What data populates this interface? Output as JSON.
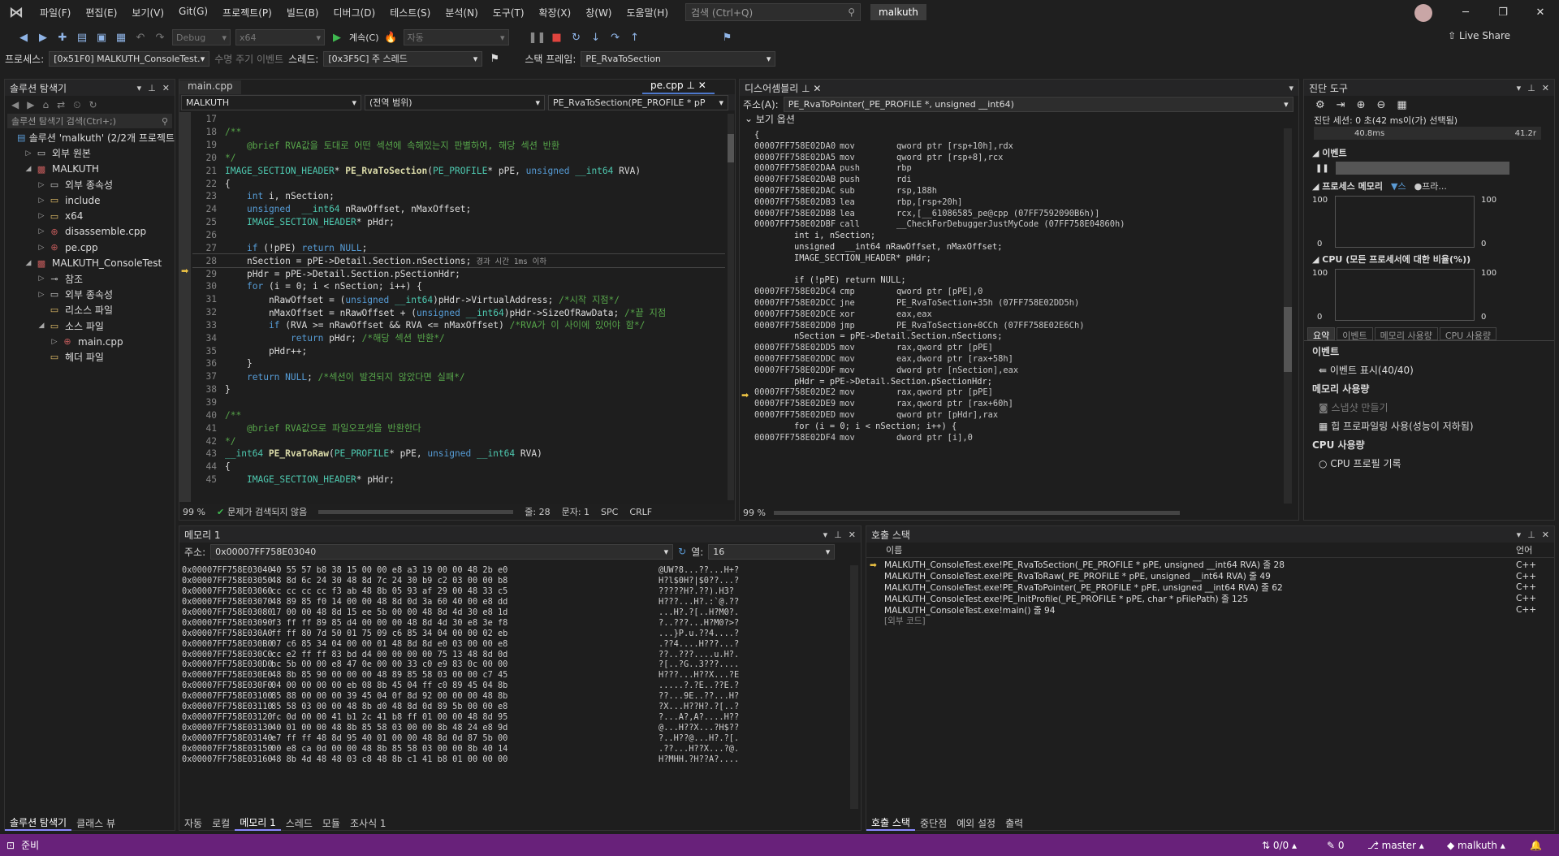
{
  "menu": [
    "파일(F)",
    "편집(E)",
    "보기(V)",
    "Git(G)",
    "프로젝트(P)",
    "빌드(B)",
    "디버그(D)",
    "테스트(S)",
    "분석(N)",
    "도구(T)",
    "확장(X)",
    "창(W)",
    "도움말(H)"
  ],
  "search_placeholder": "검색 (Ctrl+Q)",
  "solution_badge": "malkuth",
  "toolbar": {
    "config": "Debug",
    "platform": "x64",
    "continue": "계속(C)",
    "auto": "자동",
    "liveshare": "Live Share"
  },
  "toolbar2": {
    "process_label": "프로세스:",
    "process": "[0x51F0] MALKUTH_ConsoleTest.",
    "lifecycle": "수명 주기 이벤트",
    "thread_label": "스레드:",
    "thread": "[0x3F5C] 주 스레드",
    "stack_label": "스택 프레임:",
    "stack": "PE_RvaToSection"
  },
  "solution_explorer": {
    "title": "솔루션 탐색기",
    "search": "솔루션 탐색기 검색(Ctrl+;)",
    "items": [
      {
        "label": "솔루션 'malkuth' (2/2개 프로젝트"
      },
      {
        "label": "외부 원본"
      },
      {
        "label": "MALKUTH"
      },
      {
        "label": "외부 종속성"
      },
      {
        "label": "include"
      },
      {
        "label": "x64"
      },
      {
        "label": "disassemble.cpp"
      },
      {
        "label": "pe.cpp"
      },
      {
        "label": "MALKUTH_ConsoleTest"
      },
      {
        "label": "참조"
      },
      {
        "label": "외부 종속성"
      },
      {
        "label": "리소스 파일"
      },
      {
        "label": "소스 파일"
      },
      {
        "label": "main.cpp"
      },
      {
        "label": "헤더 파일"
      }
    ],
    "tabs": [
      "솔루션 탐색기",
      "클래스 뷰"
    ]
  },
  "editor": {
    "tabs": [
      "main.cpp",
      "pe.cpp"
    ],
    "nav": [
      "MALKUTH",
      "(전역 범위)",
      "PE_RvaToSection(PE_PROFILE * pP"
    ],
    "lines": [
      {
        "n": "17",
        "t": ""
      },
      {
        "n": "18",
        "t": "/**"
      },
      {
        "n": "19",
        "t": "    @brief RVA값을 토대로 어떤 섹션에 속해있는지 판별하여, 해당 섹션 반환"
      },
      {
        "n": "20",
        "t": "*/"
      },
      {
        "n": "21",
        "t": "IMAGE_SECTION_HEADER* PE_RvaToSection(PE_PROFILE* pPE, unsigned __int64 RVA)"
      },
      {
        "n": "22",
        "t": "{"
      },
      {
        "n": "23",
        "t": "    int i, nSection;"
      },
      {
        "n": "24",
        "t": "    unsigned  __int64 nRawOffset, nMaxOffset;"
      },
      {
        "n": "25",
        "t": "    IMAGE_SECTION_HEADER* pHdr;"
      },
      {
        "n": "26",
        "t": ""
      },
      {
        "n": "27",
        "t": "    if (!pPE) return NULL;"
      },
      {
        "n": "28",
        "t": "    nSection = pPE->Detail.Section.nSections;"
      },
      {
        "n": "29",
        "t": "    pHdr = pPE->Detail.Section.pSectionHdr;"
      },
      {
        "n": "30",
        "t": "    for (i = 0; i < nSection; i++) {"
      },
      {
        "n": "31",
        "t": "        nRawOffset = (unsigned __int64)pHdr->VirtualAddress; /*시작 지점*/"
      },
      {
        "n": "32",
        "t": "        nMaxOffset = nRawOffset + (unsigned __int64)pHdr->SizeOfRawData; /*끝 지점"
      },
      {
        "n": "33",
        "t": "        if (RVA >= nRawOffset && RVA <= nMaxOffset) /*RVA가 이 사이에 있어야 함*/"
      },
      {
        "n": "34",
        "t": "            return pHdr; /*해당 섹션 반환*/"
      },
      {
        "n": "35",
        "t": "        pHdr++;"
      },
      {
        "n": "36",
        "t": "    }"
      },
      {
        "n": "37",
        "t": "    return NULL; /*섹션이 발견되지 않았다면 실패*/"
      },
      {
        "n": "38",
        "t": "}"
      },
      {
        "n": "39",
        "t": ""
      },
      {
        "n": "40",
        "t": "/**"
      },
      {
        "n": "41",
        "t": "    @brief RVA값으로 파일오프셋을 반환한다"
      },
      {
        "n": "42",
        "t": "*/"
      },
      {
        "n": "43",
        "t": "__int64 PE_RvaToRaw(PE_PROFILE* pPE, unsigned __int64 RVA)"
      },
      {
        "n": "44",
        "t": "{"
      },
      {
        "n": "45",
        "t": "    IMAGE_SECTION_HEADER* pHdr;"
      }
    ],
    "elapsed": "경과 시간 1ms 이하",
    "zoom": "99 %",
    "issues": "문제가 검색되지 않음",
    "line": "줄: 28",
    "col": "문자: 1",
    "spc": "SPC",
    "crlf": "CRLF"
  },
  "disasm": {
    "title": "디스어셈블리",
    "address_label": "주소(A):",
    "address": "PE_RvaToPointer(_PE_PROFILE *, unsigned __int64)",
    "options": "보기 옵션",
    "zoom": "99 %",
    "lines": [
      {
        "k": "src",
        "t": "{"
      },
      {
        "k": "asm",
        "a": "00007FF758E02DA0",
        "o": "mov",
        "r": "qword ptr [rsp+10h],rdx"
      },
      {
        "k": "asm",
        "a": "00007FF758E02DA5",
        "o": "mov",
        "r": "qword ptr [rsp+8],rcx"
      },
      {
        "k": "asm",
        "a": "00007FF758E02DAA",
        "o": "push",
        "r": "rbp"
      },
      {
        "k": "asm",
        "a": "00007FF758E02DAB",
        "o": "push",
        "r": "rdi"
      },
      {
        "k": "asm",
        "a": "00007FF758E02DAC",
        "o": "sub",
        "r": "rsp,188h"
      },
      {
        "k": "asm",
        "a": "00007FF758E02DB3",
        "o": "lea",
        "r": "rbp,[rsp+20h]"
      },
      {
        "k": "asm",
        "a": "00007FF758E02DB8",
        "o": "lea",
        "r": "rcx,[__61086585_pe@cpp (07FF7592090B6h)]"
      },
      {
        "k": "asm",
        "a": "00007FF758E02DBF",
        "o": "call",
        "r": "__CheckForDebuggerJustMyCode (07FF758E04860h)"
      },
      {
        "k": "src",
        "t": "    int i, nSection;"
      },
      {
        "k": "src",
        "t": "    unsigned  __int64 nRawOffset, nMaxOffset;"
      },
      {
        "k": "src",
        "t": "    IMAGE_SECTION_HEADER* pHdr;"
      },
      {
        "k": "src",
        "t": ""
      },
      {
        "k": "src",
        "t": "    if (!pPE) return NULL;"
      },
      {
        "k": "asm",
        "a": "00007FF758E02DC4",
        "o": "cmp",
        "r": "qword ptr [pPE],0"
      },
      {
        "k": "asm",
        "a": "00007FF758E02DCC",
        "o": "jne",
        "r": "PE_RvaToSection+35h (07FF758E02DD5h)"
      },
      {
        "k": "asm",
        "a": "00007FF758E02DCE",
        "o": "xor",
        "r": "eax,eax"
      },
      {
        "k": "asm",
        "a": "00007FF758E02DD0",
        "o": "jmp",
        "r": "PE_RvaToSection+0CCh (07FF758E02E6Ch)"
      },
      {
        "k": "src",
        "t": "    nSection = pPE->Detail.Section.nSections;"
      },
      {
        "k": "asm",
        "a": "00007FF758E02DD5",
        "o": "mov",
        "r": "rax,qword ptr [pPE]"
      },
      {
        "k": "asm",
        "a": "00007FF758E02DDC",
        "o": "mov",
        "r": "eax,dword ptr [rax+58h]"
      },
      {
        "k": "asm",
        "a": "00007FF758E02DDF",
        "o": "mov",
        "r": "dword ptr [nSection],eax"
      },
      {
        "k": "src",
        "t": "    pHdr = pPE->Detail.Section.pSectionHdr;"
      },
      {
        "k": "asm",
        "a": "00007FF758E02DE2",
        "o": "mov",
        "r": "rax,qword ptr [pPE]"
      },
      {
        "k": "asm",
        "a": "00007FF758E02DE9",
        "o": "mov",
        "r": "rax,qword ptr [rax+60h]"
      },
      {
        "k": "asm",
        "a": "00007FF758E02DED",
        "o": "mov",
        "r": "qword ptr [pHdr],rax"
      },
      {
        "k": "src",
        "t": "    for (i = 0; i < nSection; i++) {"
      },
      {
        "k": "asm",
        "a": "00007FF758E02DF4",
        "o": "mov",
        "r": "dword ptr [i],0"
      }
    ]
  },
  "diag": {
    "title": "진단 도구",
    "session": "진단 세션: 0 초(42 ms이(가) 선택됨)",
    "t1": "40.8ms",
    "t2": "41.2r",
    "events": "이벤트",
    "proc_mem": "프로세스 메모리",
    "legend1": "스",
    "legend2": "프라...",
    "y100": "100",
    "y0": "0",
    "cpu": "CPU (모든 프로세서에 대한 비율(%))",
    "tabs": [
      "요약",
      "이벤트",
      "메모리 사용량",
      "CPU 사용량"
    ],
    "sec_events": "이벤트",
    "show_events": "이벤트 표시(40/40)",
    "sec_mem": "메모리 사용량",
    "snapshot": "스냅샷 만들기",
    "heap": "힙 프로파일링 사용(성능이 저하됨)",
    "sec_cpu": "CPU 사용량",
    "cpu_record": "CPU 프로필 기록"
  },
  "memory": {
    "title": "메모리 1",
    "addr_label": "주소:",
    "addr": "0x00007FF758E03040",
    "col_label": "열:",
    "cols": "16",
    "rows": [
      {
        "a": "0x00007FF758E03040",
        "h": "40 55 57 b8 38 15 00 00 e8 a3 19 00 00 48 2b e0",
        "c": "@UW?8...??...H+?"
      },
      {
        "a": "0x00007FF758E03050",
        "h": "48 8d 6c 24 30 48 8d 7c 24 30 b9 c2 03 00 00 b8",
        "c": "H?l$0H?|$0??...?"
      },
      {
        "a": "0x00007FF758E03060",
        "h": "cc cc cc cc f3 ab 48 8b 05 93 af 29 00 48 33 c5",
        "c": "?????H?.??).H3?"
      },
      {
        "a": "0x00007FF758E03070",
        "h": "48 89 85 f0 14 00 00 48 8d 0d 3a 60 40 00 e8 dd",
        "c": "H???...H?.:`@.??"
      },
      {
        "a": "0x00007FF758E03080",
        "h": "17 00 00 48 8d 15 ee 5b 00 00 48 8d 4d 30 e8 1d",
        "c": "...H?.?[..H?M0?."
      },
      {
        "a": "0x00007FF758E03090",
        "h": "f3 ff ff 89 85 d4 00 00 00 48 8d 4d 30 e8 3e f8",
        "c": "?..???...H?M0?>?"
      },
      {
        "a": "0x00007FF758E030A0",
        "h": "ff ff 80 7d 50 01 75 09 c6 85 34 04 00 00 02 eb",
        "c": "...}P.u.??4....?"
      },
      {
        "a": "0x00007FF758E030B0",
        "h": "07 c6 85 34 04 00 00 01 48 8d 8d e0 03 00 00 e8",
        "c": ".??4....H???...?"
      },
      {
        "a": "0x00007FF758E030C0",
        "h": "cc e2 ff ff 83 bd d4 00 00 00 00 75 13 48 8d 0d",
        "c": "??..???....u.H?."
      },
      {
        "a": "0x00007FF758E030D0",
        "h": "bc 5b 00 00 e8 47 0e 00 00 33 c0 e9 83 0c 00 00",
        "c": "?[..?G..3???...."
      },
      {
        "a": "0x00007FF758E030E0",
        "h": "48 8b 85 90 00 00 00 48 89 85 58 03 00 00 c7 45",
        "c": "H???...H??X...?E"
      },
      {
        "a": "0x00007FF758E030F0",
        "h": "04 00 00 00 00 eb 08 8b 45 04 ff c0 89 45 04 8b",
        "c": ".....?.?E..??E.?"
      },
      {
        "a": "0x00007FF758E03100",
        "h": "85 88 00 00 00 39 45 04 0f 8d 92 00 00 00 48 8b",
        "c": "??...9E..??...H?"
      },
      {
        "a": "0x00007FF758E03110",
        "h": "85 58 03 00 00 48 8b d0 48 8d 0d 89 5b 00 00 e8",
        "c": "?X...H??H?.?[..?"
      },
      {
        "a": "0x00007FF758E03120",
        "h": "fc 0d 00 00 41 b1 2c 41 b8 ff 01 00 00 48 8d 95",
        "c": "?...A?,A?....H??"
      },
      {
        "a": "0x00007FF758E03130",
        "h": "40 01 00 00 48 8b 85 58 03 00 00 8b 48 24 e8 9d",
        "c": "@...H??X...?H$??"
      },
      {
        "a": "0x00007FF758E03140",
        "h": "e7 ff ff 48 8d 95 40 01 00 00 48 8d 0d 87 5b 00",
        "c": "?..H??@...H?.?[."
      },
      {
        "a": "0x00007FF758E03150",
        "h": "00 e8 ca 0d 00 00 48 8b 85 58 03 00 00 8b 40 14",
        "c": ".??...H??X...?@."
      },
      {
        "a": "0x00007FF758E03160",
        "h": "48 8b 4d 48 48 03 c8 48 8b c1 41 b8 01 00 00 00",
        "c": "H?MHH.?H??A?...."
      }
    ]
  },
  "left_bottom_tabs": [
    "자동",
    "로컬",
    "메모리 1",
    "스레드",
    "모듈",
    "조사식 1"
  ],
  "callstack": {
    "title": "호출 스택",
    "col_name": "이름",
    "col_lang": "언어",
    "rows": [
      {
        "n": "MALKUTH_ConsoleTest.exe!PE_RvaToSection(_PE_PROFILE * pPE, unsigned __int64 RVA) 줄 28",
        "l": "C++"
      },
      {
        "n": "MALKUTH_ConsoleTest.exe!PE_RvaToRaw(_PE_PROFILE * pPE, unsigned __int64 RVA) 줄 49",
        "l": "C++"
      },
      {
        "n": "MALKUTH_ConsoleTest.exe!PE_RvaToPointer(_PE_PROFILE * pPE, unsigned __int64 RVA) 줄 62",
        "l": "C++"
      },
      {
        "n": "MALKUTH_ConsoleTest.exe!PE_InitProfile(_PE_PROFILE * pPE, char * pFilePath) 줄 125",
        "l": "C++"
      },
      {
        "n": "MALKUTH_ConsoleTest.exe!main() 줄 94",
        "l": "C++"
      },
      {
        "n": "[외부 코드]",
        "l": ""
      }
    ],
    "tabs": [
      "호출 스택",
      "중단점",
      "예외 설정",
      "출력"
    ]
  },
  "status": {
    "ready": "준비",
    "lines": "0/0",
    "pencil": "0",
    "branch": "master",
    "repo": "malkuth"
  },
  "colors": {
    "status": "#68217a",
    "accent": "#0e639c"
  }
}
